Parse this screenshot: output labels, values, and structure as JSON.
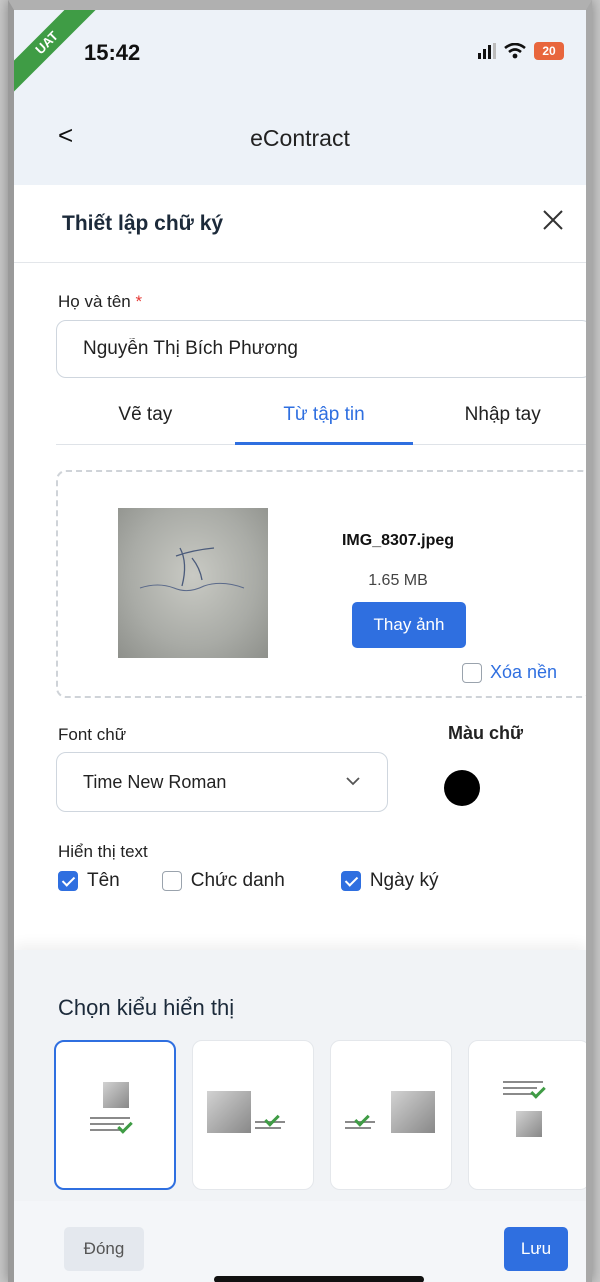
{
  "status_bar": {
    "ribbon": "UAT",
    "time": "15:42",
    "battery": "20"
  },
  "nav": {
    "back_label": "<",
    "title": "eContract"
  },
  "dialog": {
    "title": "Thiết lập chữ ký",
    "name_label": "Họ và tên",
    "name_required_mark": "*",
    "name_value": "Nguyễn Thị Bích Phương",
    "tabs": [
      {
        "label": "Vẽ tay",
        "active": false
      },
      {
        "label": "Từ tập tin",
        "active": true
      },
      {
        "label": "Nhập tay",
        "active": false
      }
    ],
    "upload": {
      "file_name": "IMG_8307.jpeg",
      "file_size": "1.65 MB",
      "change_button": "Thay ảnh",
      "remove_bg_label": "Xóa nền",
      "remove_bg_checked": false
    },
    "font_label": "Font chữ",
    "font_value": "Time New Roman",
    "color_label": "Màu chữ",
    "text_color": "#000000",
    "show_text_label": "Hiển thị text",
    "show_text_options": [
      {
        "label": "Tên",
        "checked": true
      },
      {
        "label": "Chức danh",
        "checked": false
      },
      {
        "label": "Ngày ký",
        "checked": true
      }
    ]
  },
  "display_style": {
    "title": "Chọn kiểu hiển thị",
    "selected_index": 0
  },
  "footer": {
    "close_label": "Đóng",
    "save_label": "Lưu"
  },
  "colors": {
    "accent": "#2f6fe0",
    "ribbon": "#3f9c45",
    "battery": "#e8663d"
  }
}
